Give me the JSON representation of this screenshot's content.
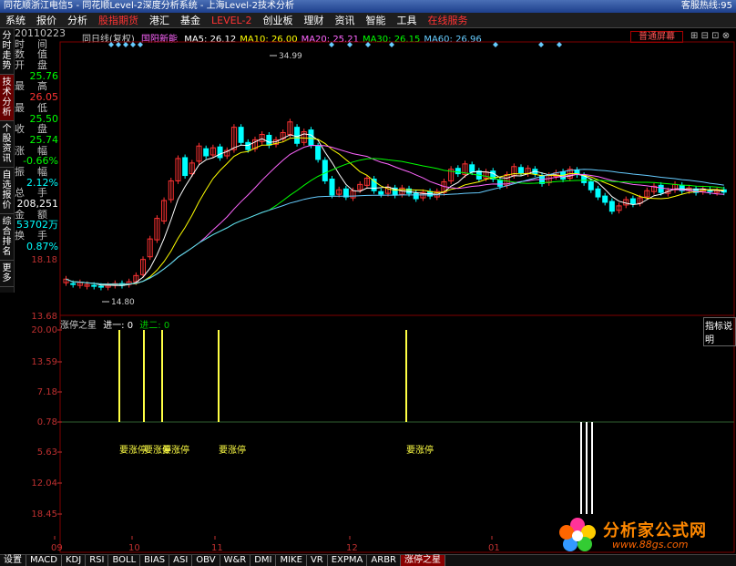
{
  "window": {
    "title": "同花顺浙江电信5 - 同花顺Level-2深度分析系统 - 上海Level-2技术分析",
    "right_text": "客服热线:95"
  },
  "menu": [
    "系统",
    "报价",
    "分析",
    "股指期货",
    "港汇",
    "基金",
    "LEVEL-2",
    "创业板",
    "理财",
    "资讯",
    "智能",
    "工具",
    "在线服务"
  ],
  "sidebar_tabs": [
    "分时走势",
    "技术分析",
    "个股资讯",
    "自选报价",
    "综合排名",
    "更多"
  ],
  "quote_panel": {
    "date": "20110223",
    "rows": [
      {
        "label": "时间",
        "value": ""
      },
      {
        "label": "数值",
        "value": ""
      },
      {
        "label": "开盘",
        "value": "25.76"
      },
      {
        "label": "最高",
        "value": "26.05"
      },
      {
        "label": "最低",
        "value": "25.50"
      },
      {
        "label": "收盘",
        "value": "25.74"
      },
      {
        "label": "涨幅",
        "value": "-0.66%"
      },
      {
        "label": "振幅",
        "value": "2.12%"
      },
      {
        "label": "总手",
        "value": "208,251"
      },
      {
        "label": "金额",
        "value": "53702万"
      },
      {
        "label": "换手",
        "value": "0.87%"
      }
    ]
  },
  "ma_legend": {
    "prefix": "同日线(复权)",
    "name": "国阳新能",
    "items": [
      {
        "label": "MA5: 26.12",
        "color": "#ffffff"
      },
      {
        "label": "MA10: 26.00",
        "color": "#ffff00"
      },
      {
        "label": "MA20: 25.21",
        "color": "#ff66ff"
      },
      {
        "label": "MA30: 26.15",
        "color": "#00ff00"
      },
      {
        "label": "MA60: 26.96",
        "color": "#66ccff"
      }
    ]
  },
  "normal_screen_button": "普通屏幕",
  "price_axis": {
    "high_label": "34.99",
    "low_label": "14.80",
    "axis_values": [
      "18.18",
      "13.68"
    ]
  },
  "indicator": {
    "title": "涨停之星",
    "param1": "进一: 0",
    "param2": "进二: 0",
    "help": "指标说明",
    "axis_values": [
      "20.00",
      "13.59",
      "7.18",
      "0.78",
      "5.63",
      "12.04",
      "18.45"
    ],
    "signal_label": "要涨停"
  },
  "x_labels": [
    "09",
    "10",
    "11",
    "12",
    "01"
  ],
  "bottom_tabs": [
    "设置",
    "MACD",
    "KDJ",
    "RSI",
    "BOLL",
    "BIAS",
    "ASI",
    "OBV",
    "W&R",
    "DMI",
    "MIKE",
    "VR",
    "EXPMA",
    "ARBR",
    "涨停之星"
  ],
  "watermark": {
    "main": "分析家公式网",
    "url": "www.88gs.com"
  },
  "colors": {
    "up": "#ff3333",
    "down": "#00ffff",
    "axis": "#c03030",
    "signal": "#ffff44"
  }
}
